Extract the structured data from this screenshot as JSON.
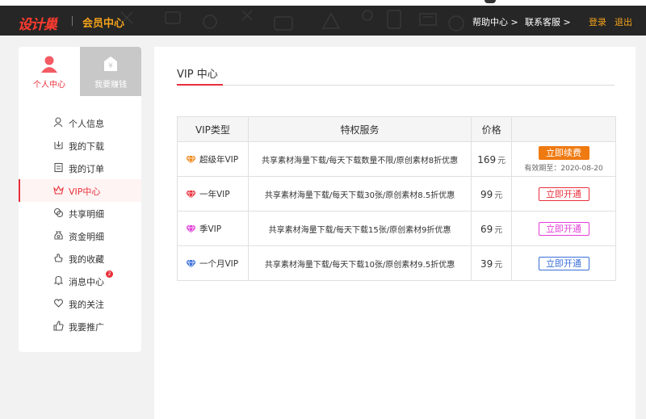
{
  "header": {
    "logo": "设计巢",
    "subtitle": "会员中心",
    "nav": {
      "help": "帮助中心 >",
      "service": "联系客服 >",
      "login": "登录",
      "logout": "退出"
    }
  },
  "sidebar": {
    "tabs": [
      {
        "label": "个人中心",
        "icon": "user-icon"
      },
      {
        "label": "我要赚钱",
        "icon": "yen-house-icon"
      }
    ],
    "items": [
      {
        "label": "个人信息",
        "icon": "user-outline-icon"
      },
      {
        "label": "我的下载",
        "icon": "download-icon"
      },
      {
        "label": "我的订单",
        "icon": "order-icon"
      },
      {
        "label": "VIP中心",
        "icon": "crown-icon",
        "active": true
      },
      {
        "label": "共享明细",
        "icon": "share-icon"
      },
      {
        "label": "资金明细",
        "icon": "money-bag-icon"
      },
      {
        "label": "我的收藏",
        "icon": "star-hand-icon"
      },
      {
        "label": "消息中心",
        "icon": "bell-icon",
        "badge": "2"
      },
      {
        "label": "我的关注",
        "icon": "heart-icon"
      },
      {
        "label": "我要推广",
        "icon": "thumbs-up-icon"
      }
    ]
  },
  "main": {
    "title": "VIP 中心",
    "table": {
      "headers": [
        "VIP类型",
        "特权服务",
        "价格",
        ""
      ],
      "rows": [
        {
          "name": "超级年VIP",
          "service": "共享素材海量下载/每天下载数量不限/原创素材8折优惠",
          "price": "169",
          "unit": "元",
          "button": "立即续费",
          "expiry": "有效期至：2020-08-20",
          "color": "#f08a1c"
        },
        {
          "name": "一年VIP",
          "service": "共享素材海量下载/每天下载30张/原创素材8.5折优惠",
          "price": "99",
          "unit": "元",
          "button": "立即开通",
          "color": "#e8303a"
        },
        {
          "name": "季VIP",
          "service": "共享素材海量下载/每天下载15张/原创素材9折优惠",
          "price": "69",
          "unit": "元",
          "button": "立即开通",
          "color": "#e23ed8"
        },
        {
          "name": "一个月VIP",
          "service": "共享素材海量下载/每天下载10张/原创素材9.5折优惠",
          "price": "39",
          "unit": "元",
          "button": "立即开通",
          "color": "#3a6fd8"
        }
      ]
    }
  }
}
